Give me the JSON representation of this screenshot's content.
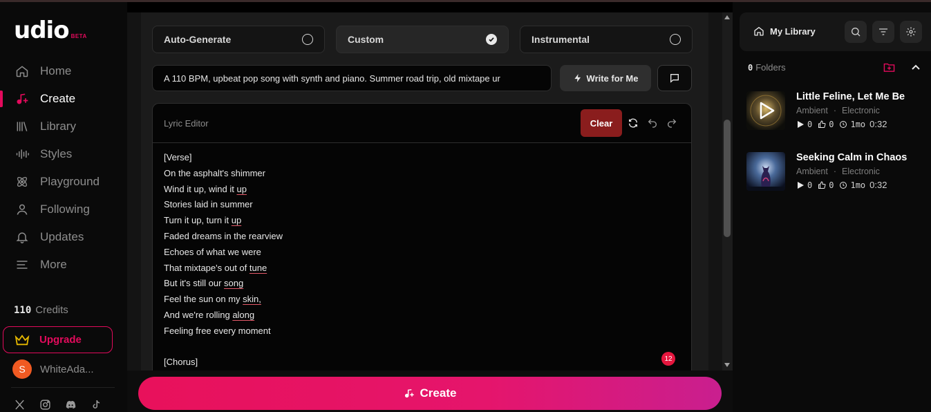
{
  "brand": {
    "name": "udio",
    "badge": "BETA",
    "accent": "#e30a5c"
  },
  "nav": [
    {
      "label": "Home",
      "icon": "home-icon",
      "active": false
    },
    {
      "label": "Create",
      "icon": "music-plus-icon",
      "active": true
    },
    {
      "label": "Library",
      "icon": "library-icon",
      "active": false
    },
    {
      "label": "Styles",
      "icon": "waveform-icon",
      "active": false
    },
    {
      "label": "Playground",
      "icon": "atom-icon",
      "active": false
    },
    {
      "label": "Following",
      "icon": "user-icon",
      "active": false
    },
    {
      "label": "Updates",
      "icon": "bell-icon",
      "active": false
    },
    {
      "label": "More",
      "icon": "menu-icon",
      "active": false
    }
  ],
  "credits": {
    "amount": "110",
    "label": "Credits"
  },
  "upgrade": {
    "label": "Upgrade"
  },
  "user": {
    "initial": "S",
    "name": "WhiteAda..."
  },
  "socials": [
    "x-icon",
    "instagram-icon",
    "discord-icon",
    "tiktok-icon"
  ],
  "modes": [
    {
      "label": "Auto-Generate",
      "selected": false
    },
    {
      "label": "Custom",
      "selected": true
    },
    {
      "label": "Instrumental",
      "selected": false
    }
  ],
  "prompt": {
    "value": "A 110 BPM, upbeat pop song with synth and piano. Summer road trip, old mixtape ur",
    "write_label": "Write for Me"
  },
  "lyric_editor": {
    "title": "Lyric Editor",
    "clear_label": "Clear",
    "badge_count": "12",
    "lines": [
      {
        "pre": "[Verse]",
        "u": ""
      },
      {
        "pre": "On the asphalt's shimmer",
        "u": ""
      },
      {
        "pre": "Wind it up, wind it ",
        "u": "up"
      },
      {
        "pre": "Stories laid in summer",
        "u": ""
      },
      {
        "pre": "Turn it up, turn it ",
        "u": "up"
      },
      {
        "pre": "Faded dreams in the rearview",
        "u": ""
      },
      {
        "pre": "Echoes of what we were",
        "u": ""
      },
      {
        "pre": "That mixtape's out of ",
        "u": "tune"
      },
      {
        "pre": "But it's still our ",
        "u": "song"
      },
      {
        "pre": "Feel the sun on my ",
        "u": "skin,"
      },
      {
        "pre": "And we're rolling ",
        "u": "along"
      },
      {
        "pre": "Feeling free every moment",
        "u": ""
      },
      {
        "pre": "",
        "u": ""
      },
      {
        "pre": "[Chorus]",
        "u": ""
      }
    ]
  },
  "create_button": {
    "label": "Create"
  },
  "library": {
    "title": "My Library",
    "folders_count": "0",
    "folders_label": "Folders",
    "tracks": [
      {
        "title": "Little Feline, Let Me Be",
        "genres": [
          "Ambient",
          "Electronic"
        ],
        "plays": "0",
        "likes": "0",
        "age": "1mo",
        "duration": "0:32"
      },
      {
        "title": "Seeking Calm in Chaos",
        "genres": [
          "Ambient",
          "Electronic"
        ],
        "plays": "0",
        "likes": "0",
        "age": "1mo",
        "duration": "0:32"
      }
    ]
  }
}
